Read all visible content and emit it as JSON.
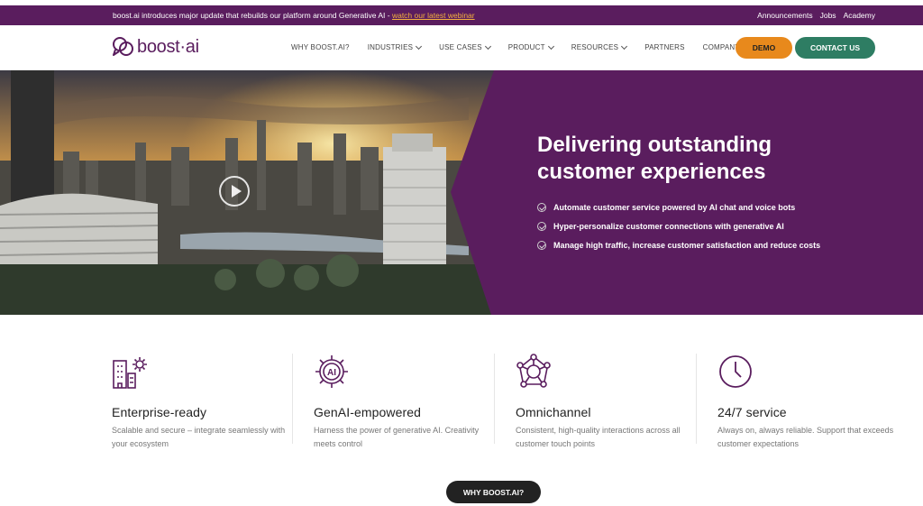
{
  "announcement": {
    "text": "boost.ai introduces major update that rebuilds our platform around Generative AI - ",
    "link": "watch our latest webinar",
    "links": [
      "Announcements",
      "Jobs",
      "Academy"
    ]
  },
  "nav": {
    "logo_text": "boost·ai",
    "menu": [
      {
        "label": "WHY BOOST.AI?",
        "dropdown": false
      },
      {
        "label": "INDUSTRIES",
        "dropdown": true
      },
      {
        "label": "USE CASES",
        "dropdown": true
      },
      {
        "label": "PRODUCT",
        "dropdown": true
      },
      {
        "label": "RESOURCES",
        "dropdown": true
      },
      {
        "label": "PARTNERS",
        "dropdown": false
      },
      {
        "label": "COMPANY",
        "dropdown": true
      }
    ],
    "demo_label": "DEMO",
    "contact_label": "CONTACT US"
  },
  "hero": {
    "title": "Delivering outstanding customer experiences",
    "bullets": [
      "Automate customer service powered by AI chat and voice bots",
      "Hyper-personalize customer connections with generative AI",
      "Manage high traffic, increase customer satisfaction and reduce costs"
    ]
  },
  "features": [
    {
      "icon": "enterprise-building-gear-icon",
      "title": "Enterprise-ready",
      "desc": "Scalable and secure – integrate seamlessly with your ecosystem"
    },
    {
      "icon": "ai-chip-icon",
      "title": "GenAI-empowered",
      "desc": "Harness the power of generative AI. Creativity meets control"
    },
    {
      "icon": "network-nodes-icon",
      "title": "Omnichannel",
      "desc": "Consistent, high-quality interactions across all customer touch points"
    },
    {
      "icon": "clock-icon",
      "title": "24/7 service",
      "desc": "Always on, always reliable. Support that exceeds customer expectations"
    }
  ],
  "cta_label": "WHY BOOST.AI?",
  "colors": {
    "brand_purple": "#5a1d5e",
    "demo_orange": "#e8891c",
    "contact_green": "#2e7d63",
    "link_yellow": "#f4b13f"
  }
}
